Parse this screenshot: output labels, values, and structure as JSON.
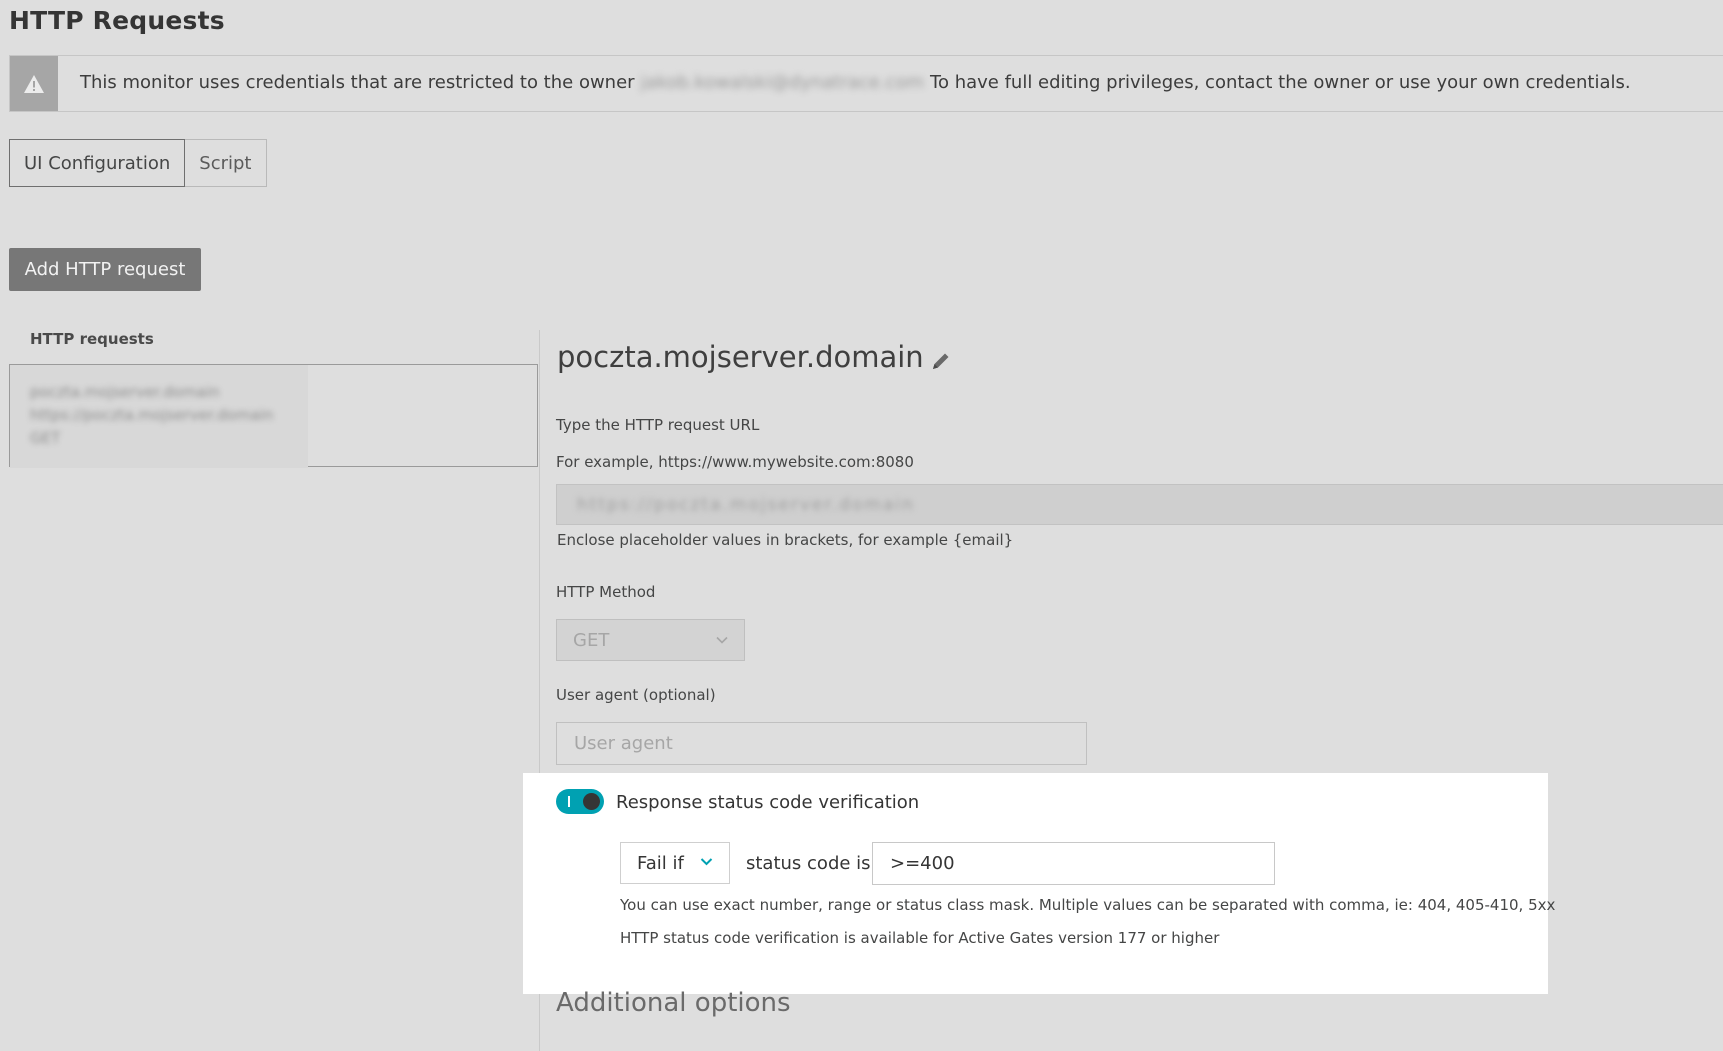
{
  "page": {
    "title": "HTTP Requests"
  },
  "warning": {
    "icon": "warning-triangle-icon",
    "text_before": "This monitor uses credentials that are restricted to the owner",
    "owner_redacted": "jakob.kowalski@dynatrace.com",
    "text_after": "To have full editing privileges, contact the owner or use your own credentials."
  },
  "tabs": [
    {
      "label": "UI Configuration",
      "active": true
    },
    {
      "label": "Script",
      "active": false
    }
  ],
  "add_button": {
    "label": "Add HTTP request"
  },
  "request_list": {
    "label": "HTTP requests",
    "items": [
      {
        "name": "poczta.mojserver.domain",
        "url": "https://poczta.mojserver.domain",
        "method": "GET"
      }
    ]
  },
  "request_detail": {
    "name": "poczta.mojserver.domain",
    "url_label": "Type the HTTP request URL",
    "url_example": "For example, https://www.mywebsite.com:8080",
    "url_value_redacted": "https://poczta.mojserver.domain",
    "url_hint": "Enclose placeholder values in brackets, for example {email}",
    "method_label": "HTTP Method",
    "method_value": "GET",
    "user_agent_label": "User agent (optional)",
    "user_agent_placeholder": "User agent"
  },
  "status_verification": {
    "toggle_label": "Response status code verification",
    "enabled": true,
    "condition": "Fail if",
    "status_label": "status code is",
    "status_value": ">=400",
    "hint1": "You can use exact number, range or status class mask. Multiple values can be separated with comma, ie: 404, 405-410, 5xx",
    "hint2": "HTTP status code verification is available for Active Gates version 177 or higher"
  },
  "additional_options": {
    "label": "Additional options"
  },
  "colors": {
    "accent": "#00a1b2",
    "background": "#dedede",
    "highlight": "#ffffff"
  }
}
